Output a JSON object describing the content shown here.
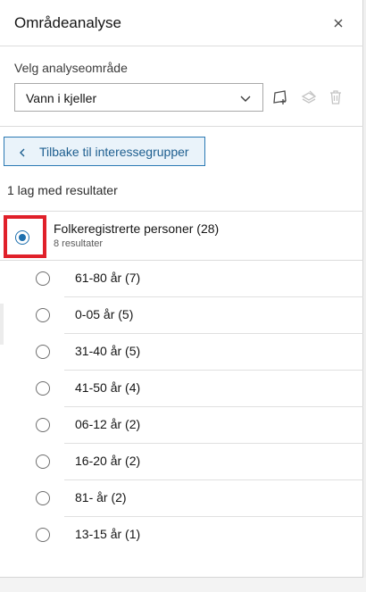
{
  "header": {
    "title": "Områdeanalyse"
  },
  "area": {
    "label": "Velg analyseområde",
    "selected": "Vann i kjeller",
    "tools": [
      "draw-area-icon",
      "layers-icon",
      "trash-icon"
    ]
  },
  "back_button": {
    "label": "Tilbake til interessegrupper"
  },
  "results_summary": "1 lag med resultater",
  "group": {
    "title": "Folkeregistrerte personer (28)",
    "subtitle": "8 resultater",
    "selected": true
  },
  "age_groups": [
    {
      "label": "61-80 år (7)"
    },
    {
      "label": "0-05 år (5)"
    },
    {
      "label": "31-40 år (5)"
    },
    {
      "label": "41-50 år (4)"
    },
    {
      "label": "06-12 år (2)"
    },
    {
      "label": "16-20 år (2)"
    },
    {
      "label": "81- år (2)"
    },
    {
      "label": "13-15 år (1)"
    }
  ],
  "colors": {
    "accent": "#1d6fae",
    "highlight": "#e0202a",
    "back_button_bg": "#eaf3fa"
  }
}
